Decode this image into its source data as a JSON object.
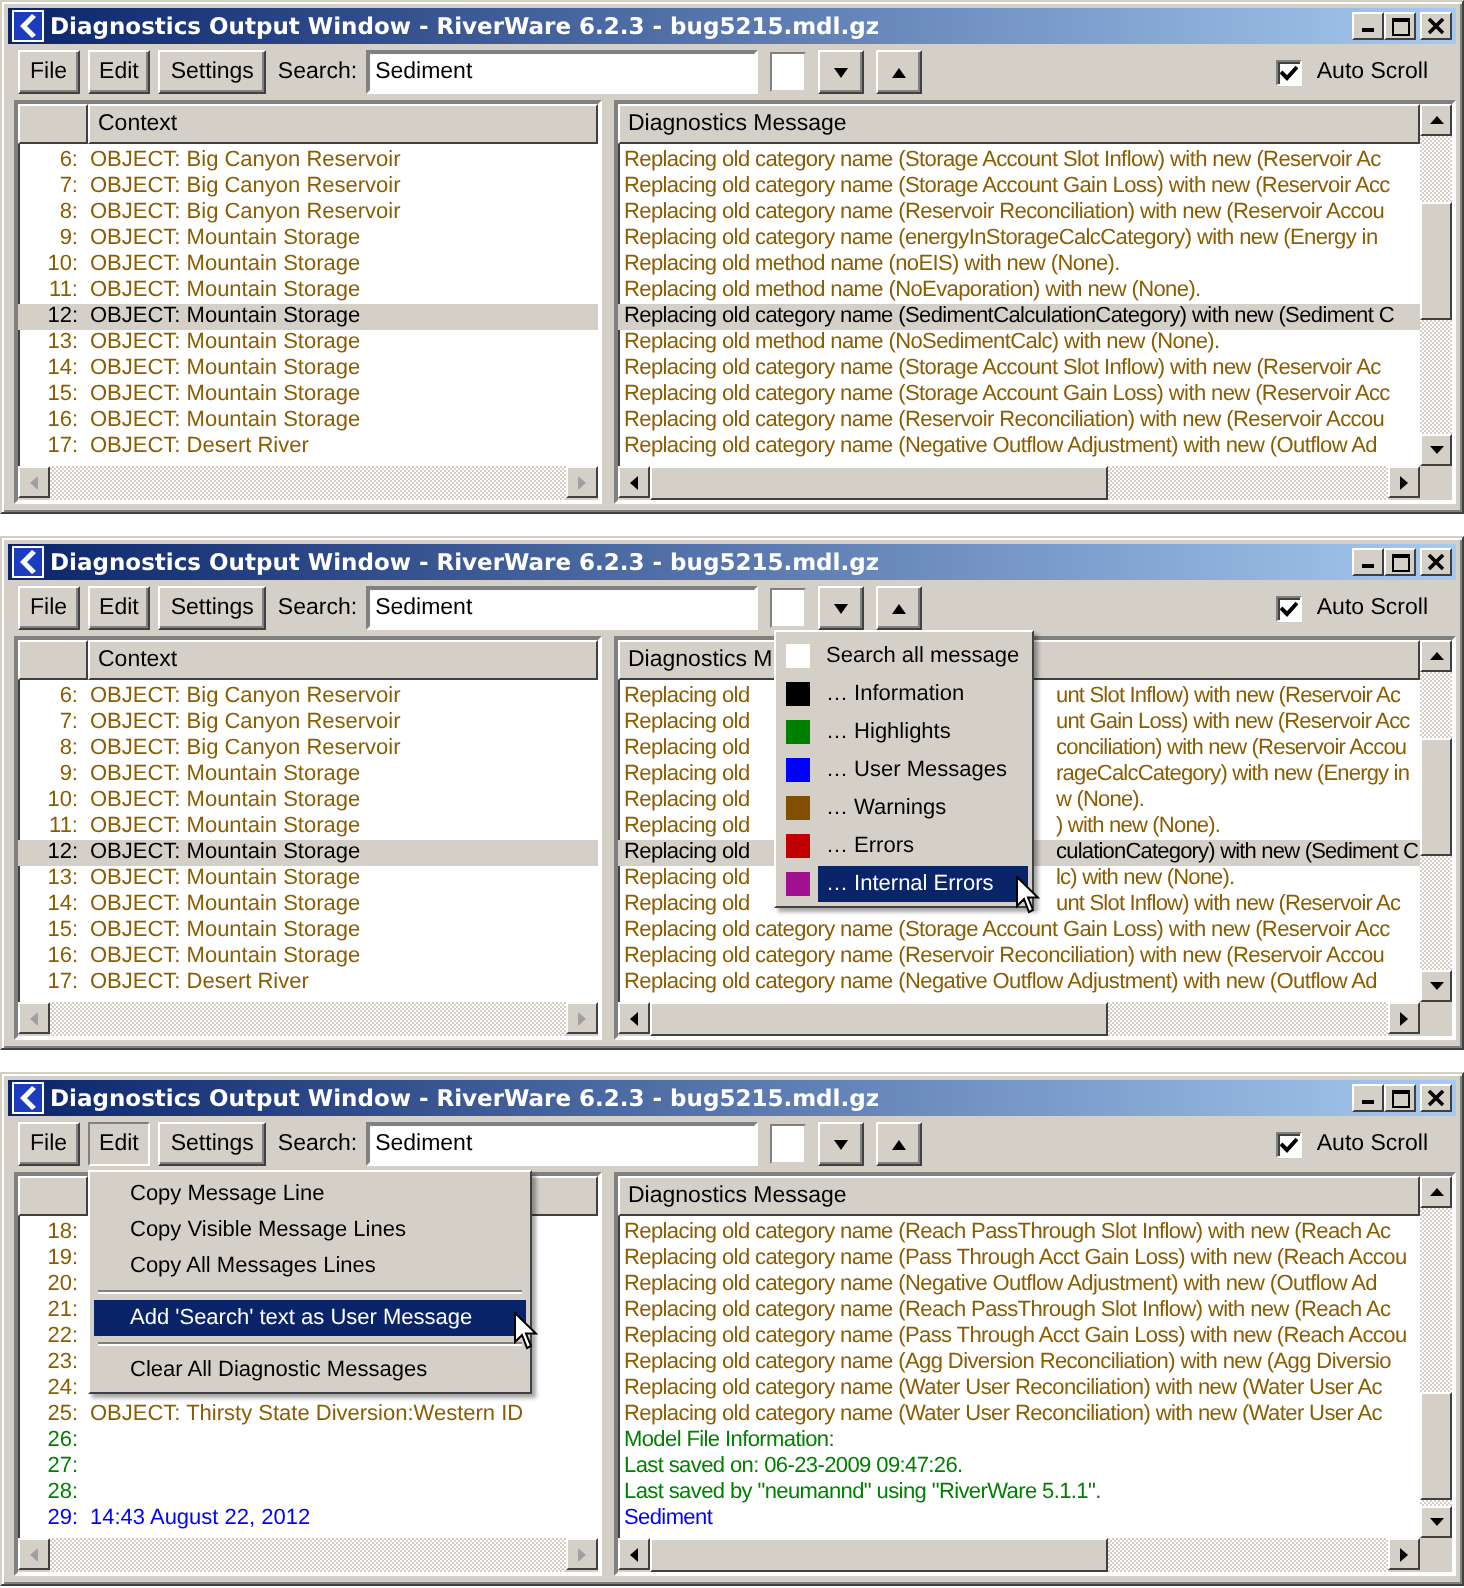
{
  "windows": [
    {
      "title": "Diagnostics Output Window - RiverWare 6.2.3 - bug5215.mdl.gz",
      "toolbar": {
        "buttons": [
          {
            "label": "File",
            "pressed": false
          },
          {
            "label": "Edit",
            "pressed": false
          },
          {
            "label": "Settings",
            "pressed": false
          }
        ],
        "search_label": "Search:",
        "search_value": "Sediment",
        "auto_scroll": {
          "label": "Auto Scroll",
          "checked": true
        }
      },
      "columns": {
        "context": "Context",
        "message": "Diagnostics Message"
      },
      "rows": [
        {
          "number": "6:",
          "context": "OBJECT: Big Canyon Reservoir",
          "message": "Replacing old category name (Storage Account Slot Inflow) with new (Reservoir Ac",
          "kind": "warning",
          "selected": false
        },
        {
          "number": "7:",
          "context": "OBJECT: Big Canyon Reservoir",
          "message": "Replacing old category name (Storage Account Gain Loss) with new (Reservoir Acc",
          "kind": "warning",
          "selected": false
        },
        {
          "number": "8:",
          "context": "OBJECT: Big Canyon Reservoir",
          "message": "Replacing old category name (Reservoir Reconciliation) with new (Reservoir Accou",
          "kind": "warning",
          "selected": false
        },
        {
          "number": "9:",
          "context": "OBJECT: Mountain Storage",
          "message": "Replacing old category name (energyInStorageCalcCategory) with new (Energy in",
          "kind": "warning",
          "selected": false
        },
        {
          "number": "10:",
          "context": "OBJECT: Mountain Storage",
          "message": "Replacing old method name (noEIS) with new (None).",
          "kind": "warning",
          "selected": false
        },
        {
          "number": "11:",
          "context": "OBJECT: Mountain Storage",
          "message": "Replacing old method name (NoEvaporation) with new (None).",
          "kind": "warning",
          "selected": false
        },
        {
          "number": "12:",
          "context": "OBJECT: Mountain Storage",
          "message": "Replacing old category name (SedimentCalculationCategory) with new (Sediment C",
          "kind": "warning",
          "selected": true
        },
        {
          "number": "13:",
          "context": "OBJECT: Mountain Storage",
          "message": "Replacing old method name (NoSedimentCalc) with new (None).",
          "kind": "warning",
          "selected": false
        },
        {
          "number": "14:",
          "context": "OBJECT: Mountain Storage",
          "message": "Replacing old category name (Storage Account Slot Inflow) with new (Reservoir Ac",
          "kind": "warning",
          "selected": false
        },
        {
          "number": "15:",
          "context": "OBJECT: Mountain Storage",
          "message": "Replacing old category name (Storage Account Gain Loss) with new (Reservoir Acc",
          "kind": "warning",
          "selected": false
        },
        {
          "number": "16:",
          "context": "OBJECT: Mountain Storage",
          "message": "Replacing old category name (Reservoir Reconciliation) with new (Reservoir Accou",
          "kind": "warning",
          "selected": false
        },
        {
          "number": "17:",
          "context": "OBJECT: Desert River",
          "message": "Replacing old category name (Negative Outflow Adjustment) with new (Outflow Ad",
          "kind": "warning",
          "selected": false
        }
      ]
    },
    {
      "title": "Diagnostics Output Window - RiverWare 6.2.3 - bug5215.mdl.gz",
      "toolbar": {
        "buttons": [
          {
            "label": "File",
            "pressed": false
          },
          {
            "label": "Edit",
            "pressed": false
          },
          {
            "label": "Settings",
            "pressed": false
          }
        ],
        "search_label": "Search:",
        "search_value": "Sediment",
        "auto_scroll": {
          "label": "Auto Scroll",
          "checked": true
        }
      },
      "columns": {
        "context": "Context",
        "message": "Diagnostics M"
      },
      "rows": [
        {
          "number": "6:",
          "context": "OBJECT: Big Canyon Reservoir",
          "message": "Replacing old",
          "message_after_menu": "unt Slot Inflow) with new (Reservoir Ac",
          "kind": "warning",
          "selected": false
        },
        {
          "number": "7:",
          "context": "OBJECT: Big Canyon Reservoir",
          "message": "Replacing old",
          "message_after_menu": "unt Gain Loss) with new (Reservoir Acc",
          "kind": "warning",
          "selected": false
        },
        {
          "number": "8:",
          "context": "OBJECT: Big Canyon Reservoir",
          "message": "Replacing old",
          "message_after_menu": "conciliation) with new (Reservoir Accou",
          "kind": "warning",
          "selected": false
        },
        {
          "number": "9:",
          "context": "OBJECT: Mountain Storage",
          "message": "Replacing old",
          "message_after_menu": "rageCalcCategory) with new (Energy in",
          "kind": "warning",
          "selected": false
        },
        {
          "number": "10:",
          "context": "OBJECT: Mountain Storage",
          "message": "Replacing old",
          "message_after_menu": "w (None).",
          "kind": "warning",
          "selected": false
        },
        {
          "number": "11:",
          "context": "OBJECT: Mountain Storage",
          "message": "Replacing old",
          "message_after_menu": ") with new (None).",
          "kind": "warning",
          "selected": false
        },
        {
          "number": "12:",
          "context": "OBJECT: Mountain Storage",
          "message": "Replacing old",
          "message_after_menu": "culationCategory) with new (Sediment C",
          "kind": "warning",
          "selected": true
        },
        {
          "number": "13:",
          "context": "OBJECT: Mountain Storage",
          "message": "Replacing old",
          "message_after_menu": "lc) with new (None).",
          "kind": "warning",
          "selected": false
        },
        {
          "number": "14:",
          "context": "OBJECT: Mountain Storage",
          "message": "Replacing old",
          "message_after_menu": "unt Slot Inflow) with new (Reservoir Ac",
          "kind": "warning",
          "selected": false
        },
        {
          "number": "15:",
          "context": "OBJECT: Mountain Storage",
          "message": "Replacing old category name (Storage Account Gain Loss) with new (Reservoir Acc",
          "kind": "warning",
          "selected": false
        },
        {
          "number": "16:",
          "context": "OBJECT: Mountain Storage",
          "message": "Replacing old category name (Reservoir Reconciliation) with new (Reservoir Accou",
          "kind": "warning",
          "selected": false
        },
        {
          "number": "17:",
          "context": "OBJECT: Desert River",
          "message": "Replacing old category name (Negative Outflow Adjustment) with new (Outflow Ad",
          "kind": "warning",
          "selected": false
        }
      ],
      "menu": {
        "kind": "filter",
        "items": [
          {
            "label": "Search all message",
            "color": "#ffffff",
            "selected": false
          },
          {
            "label": "… Information",
            "color": "#000000",
            "selected": false
          },
          {
            "label": "… Highlights",
            "color": "#008000",
            "selected": false
          },
          {
            "label": "… User Messages",
            "color": "#0000ff",
            "selected": false
          },
          {
            "label": "… Warnings",
            "color": "#805000",
            "selected": false
          },
          {
            "label": "… Errors",
            "color": "#c00000",
            "selected": false
          },
          {
            "label": "… Internal Errors",
            "color": "#a01090",
            "selected": true
          }
        ]
      }
    },
    {
      "title": "Diagnostics Output Window - RiverWare 6.2.3 - bug5215.mdl.gz",
      "toolbar": {
        "buttons": [
          {
            "label": "File",
            "pressed": false
          },
          {
            "label": "Edit",
            "pressed": true
          },
          {
            "label": "Settings",
            "pressed": false
          }
        ],
        "search_label": "Search:",
        "search_value": "Sediment",
        "auto_scroll": {
          "label": "Auto Scroll",
          "checked": true
        }
      },
      "columns": {
        "message": "Diagnostics Message"
      },
      "rows": [
        {
          "number": "18:",
          "message": "Replacing old category name (Reach PassThrough Slot Inflow) with new (Reach Ac",
          "kind": "warning",
          "selected": false
        },
        {
          "number": "19:",
          "message": "Replacing old category name (Pass Through Acct Gain Loss) with new (Reach Accou",
          "kind": "warning",
          "selected": false
        },
        {
          "number": "20:",
          "message": "Replacing old category name (Negative Outflow Adjustment) with new (Outflow Ad",
          "kind": "warning",
          "selected": false
        },
        {
          "number": "21:",
          "message": "Replacing old category name (Reach PassThrough Slot Inflow) with new (Reach Ac",
          "kind": "warning",
          "selected": false
        },
        {
          "number": "22:",
          "message": "Replacing old category name (Pass Through Acct Gain Loss) with new (Reach Accou",
          "kind": "warning",
          "selected": false
        },
        {
          "number": "23:",
          "message": "Replacing old category name (Agg Diversion Reconciliation) with new (Agg Diversio",
          "kind": "warning",
          "selected": false
        },
        {
          "number": "24:",
          "message": "Replacing old category name (Water User Reconciliation) with new (Water User Ac",
          "kind": "warning",
          "selected": false
        },
        {
          "number": "25:",
          "context": "OBJECT: Thirsty State Diversion:Western ID",
          "message": "Replacing old category name (Water User Reconciliation) with new (Water User Ac",
          "kind": "warning",
          "selected": false
        },
        {
          "number": "26:",
          "message": "Model File Information:",
          "kind": "highlight",
          "selected": false
        },
        {
          "number": "27:",
          "message": "Last saved on: 06-23-2009 09:47:26.",
          "kind": "highlight",
          "selected": false
        },
        {
          "number": "28:",
          "message": "Last saved by \"neumannd\" using \"RiverWare 5.1.1\".",
          "kind": "highlight",
          "selected": false
        },
        {
          "number": "29:",
          "context": "14:43 August 22, 2012",
          "message": "Sediment",
          "kind": "user",
          "selected": false
        }
      ],
      "menu": {
        "kind": "edit",
        "groups": [
          [
            {
              "label": "Copy Message Line",
              "selected": false
            },
            {
              "label": "Copy Visible Message Lines",
              "selected": false
            },
            {
              "label": "Copy All Messages Lines",
              "selected": false
            }
          ],
          [
            {
              "label": "Add 'Search' text as User Message",
              "selected": true
            }
          ],
          [
            {
              "label": "Clear All Diagnostic Messages",
              "selected": false
            }
          ]
        ]
      }
    }
  ]
}
